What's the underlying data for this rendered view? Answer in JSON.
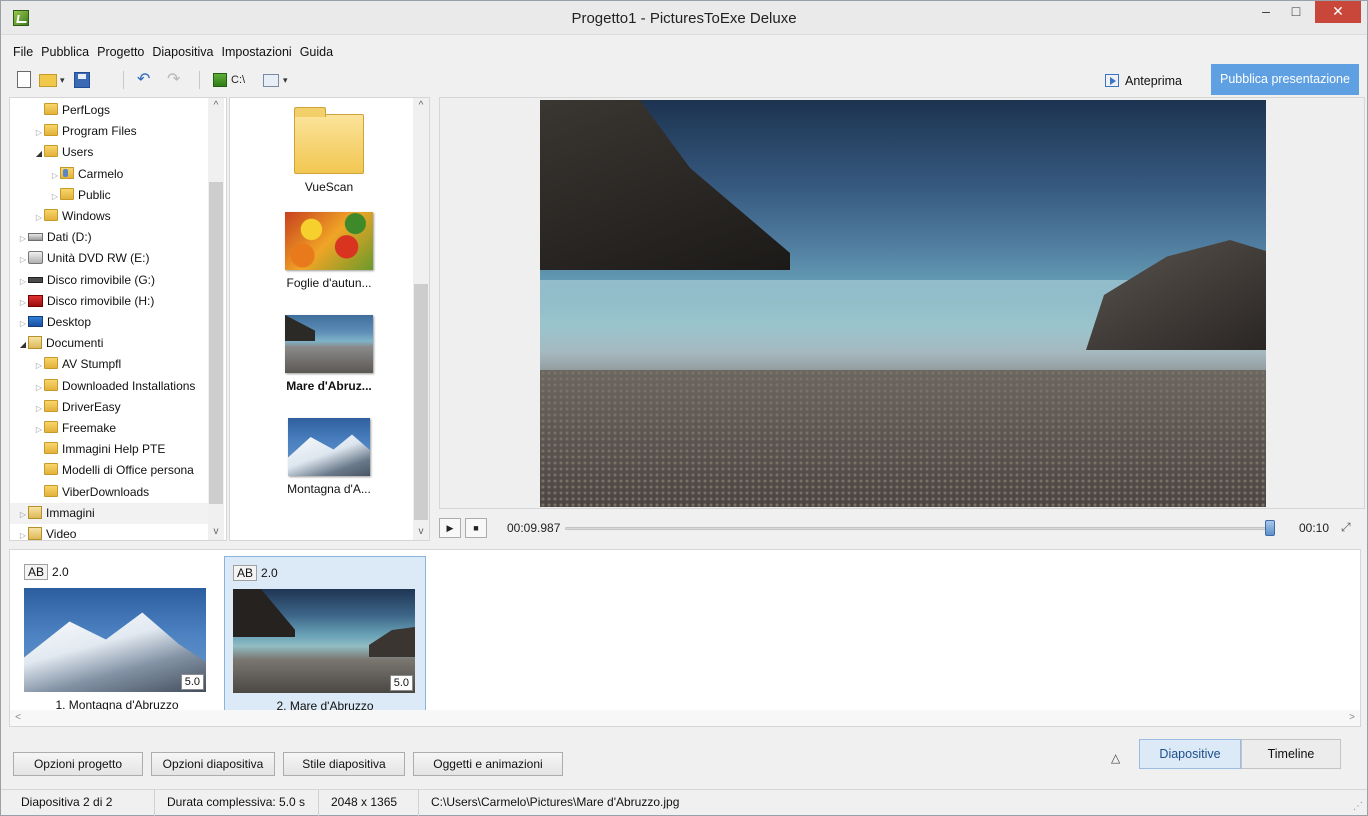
{
  "window": {
    "title": "Progetto1 - PicturesToExe Deluxe",
    "minimize_glyph": "–",
    "maximize_glyph": "□",
    "close_glyph": "✕"
  },
  "menu": [
    "File",
    "Pubblica",
    "Progetto",
    "Diapositiva",
    "Impostazioni",
    "Guida"
  ],
  "toolbar": {
    "drive_label": "C:\\",
    "preview_label": "Anteprima",
    "publish_label": "Pubblica presentazione",
    "icons": [
      "new-document",
      "open-folder",
      "save",
      "undo",
      "redo",
      "drive",
      "view-mode"
    ]
  },
  "tree": {
    "items": [
      {
        "label": "PerfLogs",
        "icon": "folder",
        "indent": 1,
        "expander": ""
      },
      {
        "label": "Program Files",
        "icon": "folder",
        "indent": 1,
        "expander": "▷"
      },
      {
        "label": "Users",
        "icon": "folder",
        "indent": 1,
        "expander": "◢"
      },
      {
        "label": "Carmelo",
        "icon": "user-folder",
        "indent": 2,
        "expander": "▷"
      },
      {
        "label": "Public",
        "icon": "folder",
        "indent": 2,
        "expander": "▷"
      },
      {
        "label": "Windows",
        "icon": "folder",
        "indent": 1,
        "expander": "▷"
      },
      {
        "label": "Dati (D:)",
        "icon": "drive",
        "indent": 0,
        "expander": "▷"
      },
      {
        "label": "Unità DVD RW (E:)",
        "icon": "dvd",
        "indent": 0,
        "expander": "▷"
      },
      {
        "label": "Disco rimovibile (G:)",
        "icon": "usb",
        "indent": 0,
        "expander": "▷"
      },
      {
        "label": "Disco rimovibile (H:)",
        "icon": "usb-red",
        "indent": 0,
        "expander": "▷"
      },
      {
        "label": "Desktop",
        "icon": "desktop",
        "indent": 0,
        "expander": "▷"
      },
      {
        "label": "Documenti",
        "icon": "documents",
        "indent": 0,
        "expander": "◢"
      },
      {
        "label": "AV Stumpfl",
        "icon": "folder",
        "indent": 1,
        "expander": "▷"
      },
      {
        "label": "Downloaded Installations",
        "icon": "folder",
        "indent": 1,
        "expander": "▷"
      },
      {
        "label": "DriverEasy",
        "icon": "folder",
        "indent": 1,
        "expander": "▷"
      },
      {
        "label": "Freemake",
        "icon": "folder",
        "indent": 1,
        "expander": "▷"
      },
      {
        "label": "Immagini Help PTE",
        "icon": "folder",
        "indent": 1,
        "expander": ""
      },
      {
        "label": "Modelli di Office persona",
        "icon": "folder",
        "indent": 1,
        "expander": ""
      },
      {
        "label": "ViberDownloads",
        "icon": "folder",
        "indent": 1,
        "expander": ""
      },
      {
        "label": "Immagini",
        "icon": "documents",
        "indent": 0,
        "expander": "▷",
        "selected": true
      },
      {
        "label": "Video",
        "icon": "documents",
        "indent": 0,
        "expander": "▷"
      }
    ],
    "scroll_up": "^",
    "scroll_down": "v"
  },
  "files": {
    "items": [
      {
        "label": "VueScan",
        "type": "folder",
        "bold": false
      },
      {
        "label": "Foglie d'autun...",
        "type": "leaves",
        "bold": false
      },
      {
        "label": "Mare d'Abruz...",
        "type": "sea",
        "bold": true
      },
      {
        "label": "Montagna d'A...",
        "type": "mountain",
        "bold": false
      }
    ],
    "scroll_up": "^",
    "scroll_down": "v"
  },
  "playback": {
    "play_glyph": "▶",
    "stop_glyph": "■",
    "current_time": "00:09.987",
    "total_time": "00:10",
    "progress": 0.9987,
    "fullscreen_glyph": "⤢"
  },
  "slides": [
    {
      "transition": "AB",
      "transition_duration": "2.0",
      "duration": "5.0",
      "label": "1. Montagna d'Abruzzo",
      "image": "mountain",
      "selected": false
    },
    {
      "transition": "AB",
      "transition_duration": "2.0",
      "duration": "5.0",
      "label": "2. Mare d'Abruzzo",
      "image": "sea",
      "selected": true
    }
  ],
  "strip_scroll": {
    "left": "<",
    "right": ">"
  },
  "bottom_buttons": [
    "Opzioni progetto",
    "Opzioni diapositiva",
    "Stile diapositiva",
    "Oggetti e animazioni"
  ],
  "collapse_glyph": "△",
  "view_tabs": [
    {
      "label": "Diapositive",
      "active": true
    },
    {
      "label": "Timeline",
      "active": false
    }
  ],
  "status": {
    "slide": "Diapositiva 2 di 2",
    "duration": "Durata complessiva: 5.0 s",
    "resolution": "2048 x 1365",
    "path": "C:\\Users\\Carmelo\\Pictures\\Mare d'Abruzzo.jpg",
    "grip": "⋰"
  },
  "colors": {
    "accent": "#5fa0e2",
    "selection": "#dce9f6",
    "close_button": "#c9473a"
  }
}
